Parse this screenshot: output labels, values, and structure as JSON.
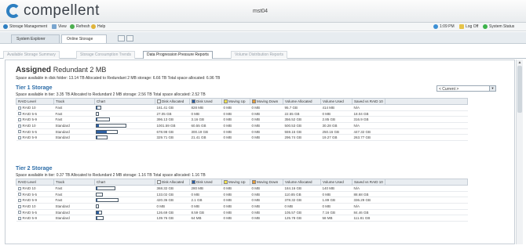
{
  "app": {
    "brand": "compellent",
    "hostname": "mst04"
  },
  "menu": {
    "storage_management": "Storage Management",
    "view": "View",
    "refresh": "Refresh",
    "help": "Help",
    "time": "1:09 PM",
    "log_off": "Log Off",
    "system_status": "System Status"
  },
  "top_tabs": [
    "System Explorer",
    "Online Storage"
  ],
  "sub_tabs": [
    "Available Storage Summary",
    "Storage Consumption Trends",
    "Data Progression Pressure Reports",
    "Volume Distribution Reports"
  ],
  "report": {
    "assigned_label": "Assigned",
    "assigned_sub": "Redundant 2 MB",
    "summary": "Space available in disk folder: 13.14 TB    Allocated to Redundant 2 MB storage: 6.66 TB    Total space allocated: 6.96 TB",
    "dropdown_value": "< Current >"
  },
  "columns": {
    "raid": "RAID Level",
    "track": "Track",
    "chart": "Chart",
    "disk_allocated": "Disk Allocated",
    "disk_used": "Disk Used",
    "moving_up": "Moving Up",
    "moving_down": "Moving Down",
    "volume_allocated": "Volume Allocated",
    "volume_used": "Volume Used",
    "saved": "Saved vs RAID 10"
  },
  "legend_colors": {
    "disk_allocated": "#ffffff",
    "disk_used": "#2c5fa3",
    "moving_up": "#f0e24a",
    "moving_down": "#e39b3a"
  },
  "tier1": {
    "title": "Tier 1 Storage",
    "summary": "Space available in tier: 3.35 TB    Allocated to Redundant 2 MB storage: 2.56 TB    Total space allocated: 2.52 TB",
    "rows": [
      {
        "raid": "RAID 10",
        "track": "Fast",
        "disk_allocated": "161.41 GB",
        "disk_used": "828 MB",
        "moving_up": "0 MB",
        "moving_down": "0 MB",
        "volume_allocated": "95.7 GB",
        "volume_used": "414 MB",
        "saved": "N/A",
        "alloc_frac": 0.1,
        "used_frac": 0.01
      },
      {
        "raid": "RAID 5-5",
        "track": "Fast",
        "disk_allocated": "27.05 GB",
        "disk_used": "0 MB",
        "moving_up": "0 MB",
        "moving_down": "0 MB",
        "volume_allocated": "22.55 GB",
        "volume_used": "0 MB",
        "saved": "18.04 GB",
        "alloc_frac": 0.02,
        "used_frac": 0.0
      },
      {
        "raid": "RAID 5-9",
        "track": "Fast",
        "disk_allocated": "396.13 GB",
        "disk_used": "3.16 GB",
        "moving_up": "0 MB",
        "moving_down": "0 MB",
        "volume_allocated": "356.52 GB",
        "volume_used": "2.85 GB",
        "saved": "316.9 GB",
        "alloc_frac": 0.25,
        "used_frac": 0.02
      },
      {
        "raid": "RAID 10",
        "track": "Standard",
        "disk_allocated": "1001.59 GB",
        "disk_used": "60.55 GB",
        "moving_up": "0 MB",
        "moving_down": "0 MB",
        "volume_allocated": "500.53 GB",
        "volume_used": "30.28 GB",
        "saved": "N/A",
        "alloc_frac": 0.55,
        "used_frac": 0.04
      },
      {
        "raid": "RAID 5-5",
        "track": "Standard",
        "disk_allocated": "678.98 GB",
        "disk_used": "300.19 GB",
        "moving_up": "0 MB",
        "moving_down": "0 MB",
        "volume_allocated": "559.15 GB",
        "volume_used": "250.16 GB",
        "saved": "447.32 GB",
        "alloc_frac": 0.4,
        "used_frac": 0.18
      },
      {
        "raid": "RAID 5-9",
        "track": "Standard",
        "disk_allocated": "329.71 GB",
        "disk_used": "21.41 GB",
        "moving_up": "0 MB",
        "moving_down": "0 MB",
        "volume_allocated": "296.74 GB",
        "volume_used": "19.27 GB",
        "saved": "263.77 GB",
        "alloc_frac": 0.21,
        "used_frac": 0.02
      }
    ]
  },
  "tier2": {
    "title": "Tier 2 Storage",
    "summary": "Space available in tier: 0.37 TB    Allocated to Redundant 2 MB storage: 1.16 TB    Total space allocated: 1.16 TB",
    "rows": [
      {
        "raid": "RAID 10",
        "track": "Fast",
        "disk_allocated": "368.32 GB",
        "disk_used": "280 MB",
        "moving_up": "0 MB",
        "moving_down": "0 MB",
        "volume_allocated": "184.16 GB",
        "volume_used": "140 MB",
        "saved": "N/A",
        "alloc_frac": 0.36,
        "used_frac": 0.01
      },
      {
        "raid": "RAID 5-5",
        "track": "Fast",
        "disk_allocated": "133.02 GB",
        "disk_used": "0 MB",
        "moving_up": "0 MB",
        "moving_down": "0 MB",
        "volume_allocated": "110.85 GB",
        "volume_used": "0 MB",
        "saved": "88.68 GB",
        "alloc_frac": 0.13,
        "used_frac": 0.0
      },
      {
        "raid": "RAID 5-9",
        "track": "Fast",
        "disk_allocated": "420.36 GB",
        "disk_used": "2.1 GB",
        "moving_up": "0 MB",
        "moving_down": "0 MB",
        "volume_allocated": "378.32 GB",
        "volume_used": "1.89 GB",
        "saved": "336.29 GB",
        "alloc_frac": 0.41,
        "used_frac": 0.02
      },
      {
        "raid": "RAID 10",
        "track": "Standard",
        "disk_allocated": "0 MB",
        "disk_used": "0 MB",
        "moving_up": "0 MB",
        "moving_down": "0 MB",
        "volume_allocated": "0 MB",
        "volume_used": "0 MB",
        "saved": "N/A",
        "alloc_frac": 0.0,
        "used_frac": 0.0
      },
      {
        "raid": "RAID 5-5",
        "track": "Standard",
        "disk_allocated": "126.69 GB",
        "disk_used": "8.59 GB",
        "moving_up": "0 MB",
        "moving_down": "0 MB",
        "volume_allocated": "105.57 GB",
        "volume_used": "7.16 GB",
        "saved": "84.46 GB",
        "alloc_frac": 0.12,
        "used_frac": 0.04
      },
      {
        "raid": "RAID 5-9",
        "track": "Standard",
        "disk_allocated": "139.76 GB",
        "disk_used": "64 MB",
        "moving_up": "0 MB",
        "moving_down": "0 MB",
        "volume_allocated": "125.78 GB",
        "volume_used": "58 MB",
        "saved": "111.81 GB",
        "alloc_frac": 0.14,
        "used_frac": 0.01
      }
    ]
  }
}
